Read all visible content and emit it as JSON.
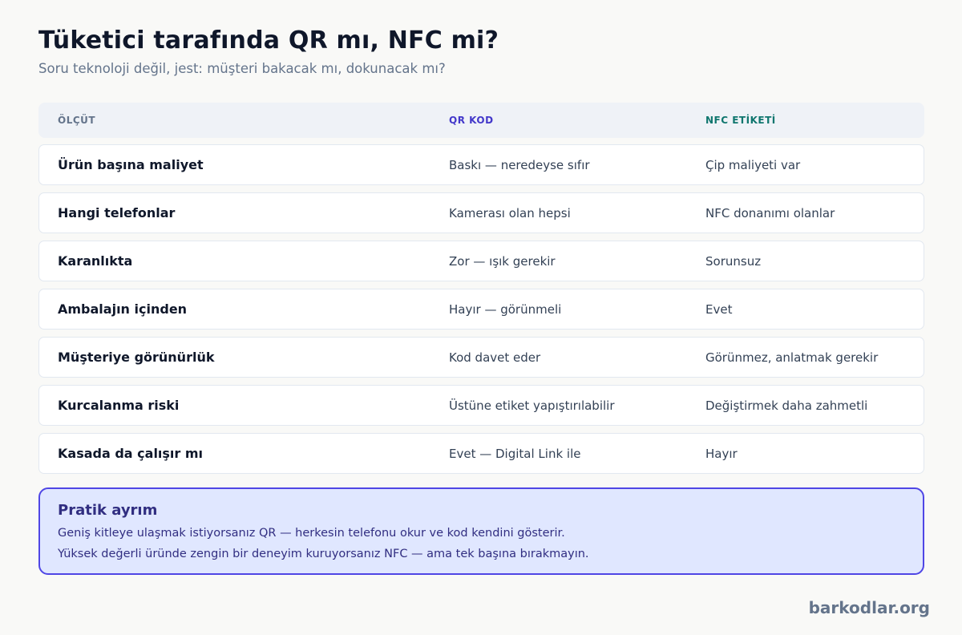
{
  "header": {
    "title": "Tüketici tarafında QR mı, NFC mi?",
    "subtitle": "Soru teknoloji değil, jest: müşteri bakacak mı, dokunacak mı?"
  },
  "table": {
    "columns": [
      "ÖLÇÜT",
      "QR KOD",
      "NFC ETİKETİ"
    ],
    "rows": [
      {
        "criterion": "Ürün başına maliyet",
        "qr": "Baskı — neredeyse sıfır",
        "nfc": "Çip maliyeti var"
      },
      {
        "criterion": "Hangi telefonlar",
        "qr": "Kamerası olan hepsi",
        "nfc": "NFC donanımı olanlar"
      },
      {
        "criterion": "Karanlıkta",
        "qr": "Zor — ışık gerekir",
        "nfc": "Sorunsuz"
      },
      {
        "criterion": "Ambalajın içinden",
        "qr": "Hayır — görünmeli",
        "nfc": "Evet"
      },
      {
        "criterion": "Müşteriye görünürlük",
        "qr": "Kod davet eder",
        "nfc": "Görünmez, anlatmak gerekir"
      },
      {
        "criterion": "Kurcalanma riski",
        "qr": "Üstüne etiket yapıştırılabilir",
        "nfc": "Değiştirmek daha zahmetli"
      },
      {
        "criterion": "Kasada da çalışır mı",
        "qr": "Evet — Digital Link ile",
        "nfc": "Hayır"
      }
    ]
  },
  "callout": {
    "title": "Pratik ayrım",
    "lines": [
      "Geniş kitleye ulaşmak istiyorsanız QR — herkesin telefonu okur ve kod kendini gösterir.",
      "Yüksek değerli üründe zengin bir deneyim kuruyorsanız NFC — ama tek başına bırakmayın."
    ]
  },
  "footer": {
    "brand": "barkodlar.org"
  },
  "colors": {
    "qr_accent": "#4338ca",
    "nfc_accent": "#0f766e",
    "callout_border": "#4f46e5",
    "callout_bg": "#e0e7ff"
  }
}
